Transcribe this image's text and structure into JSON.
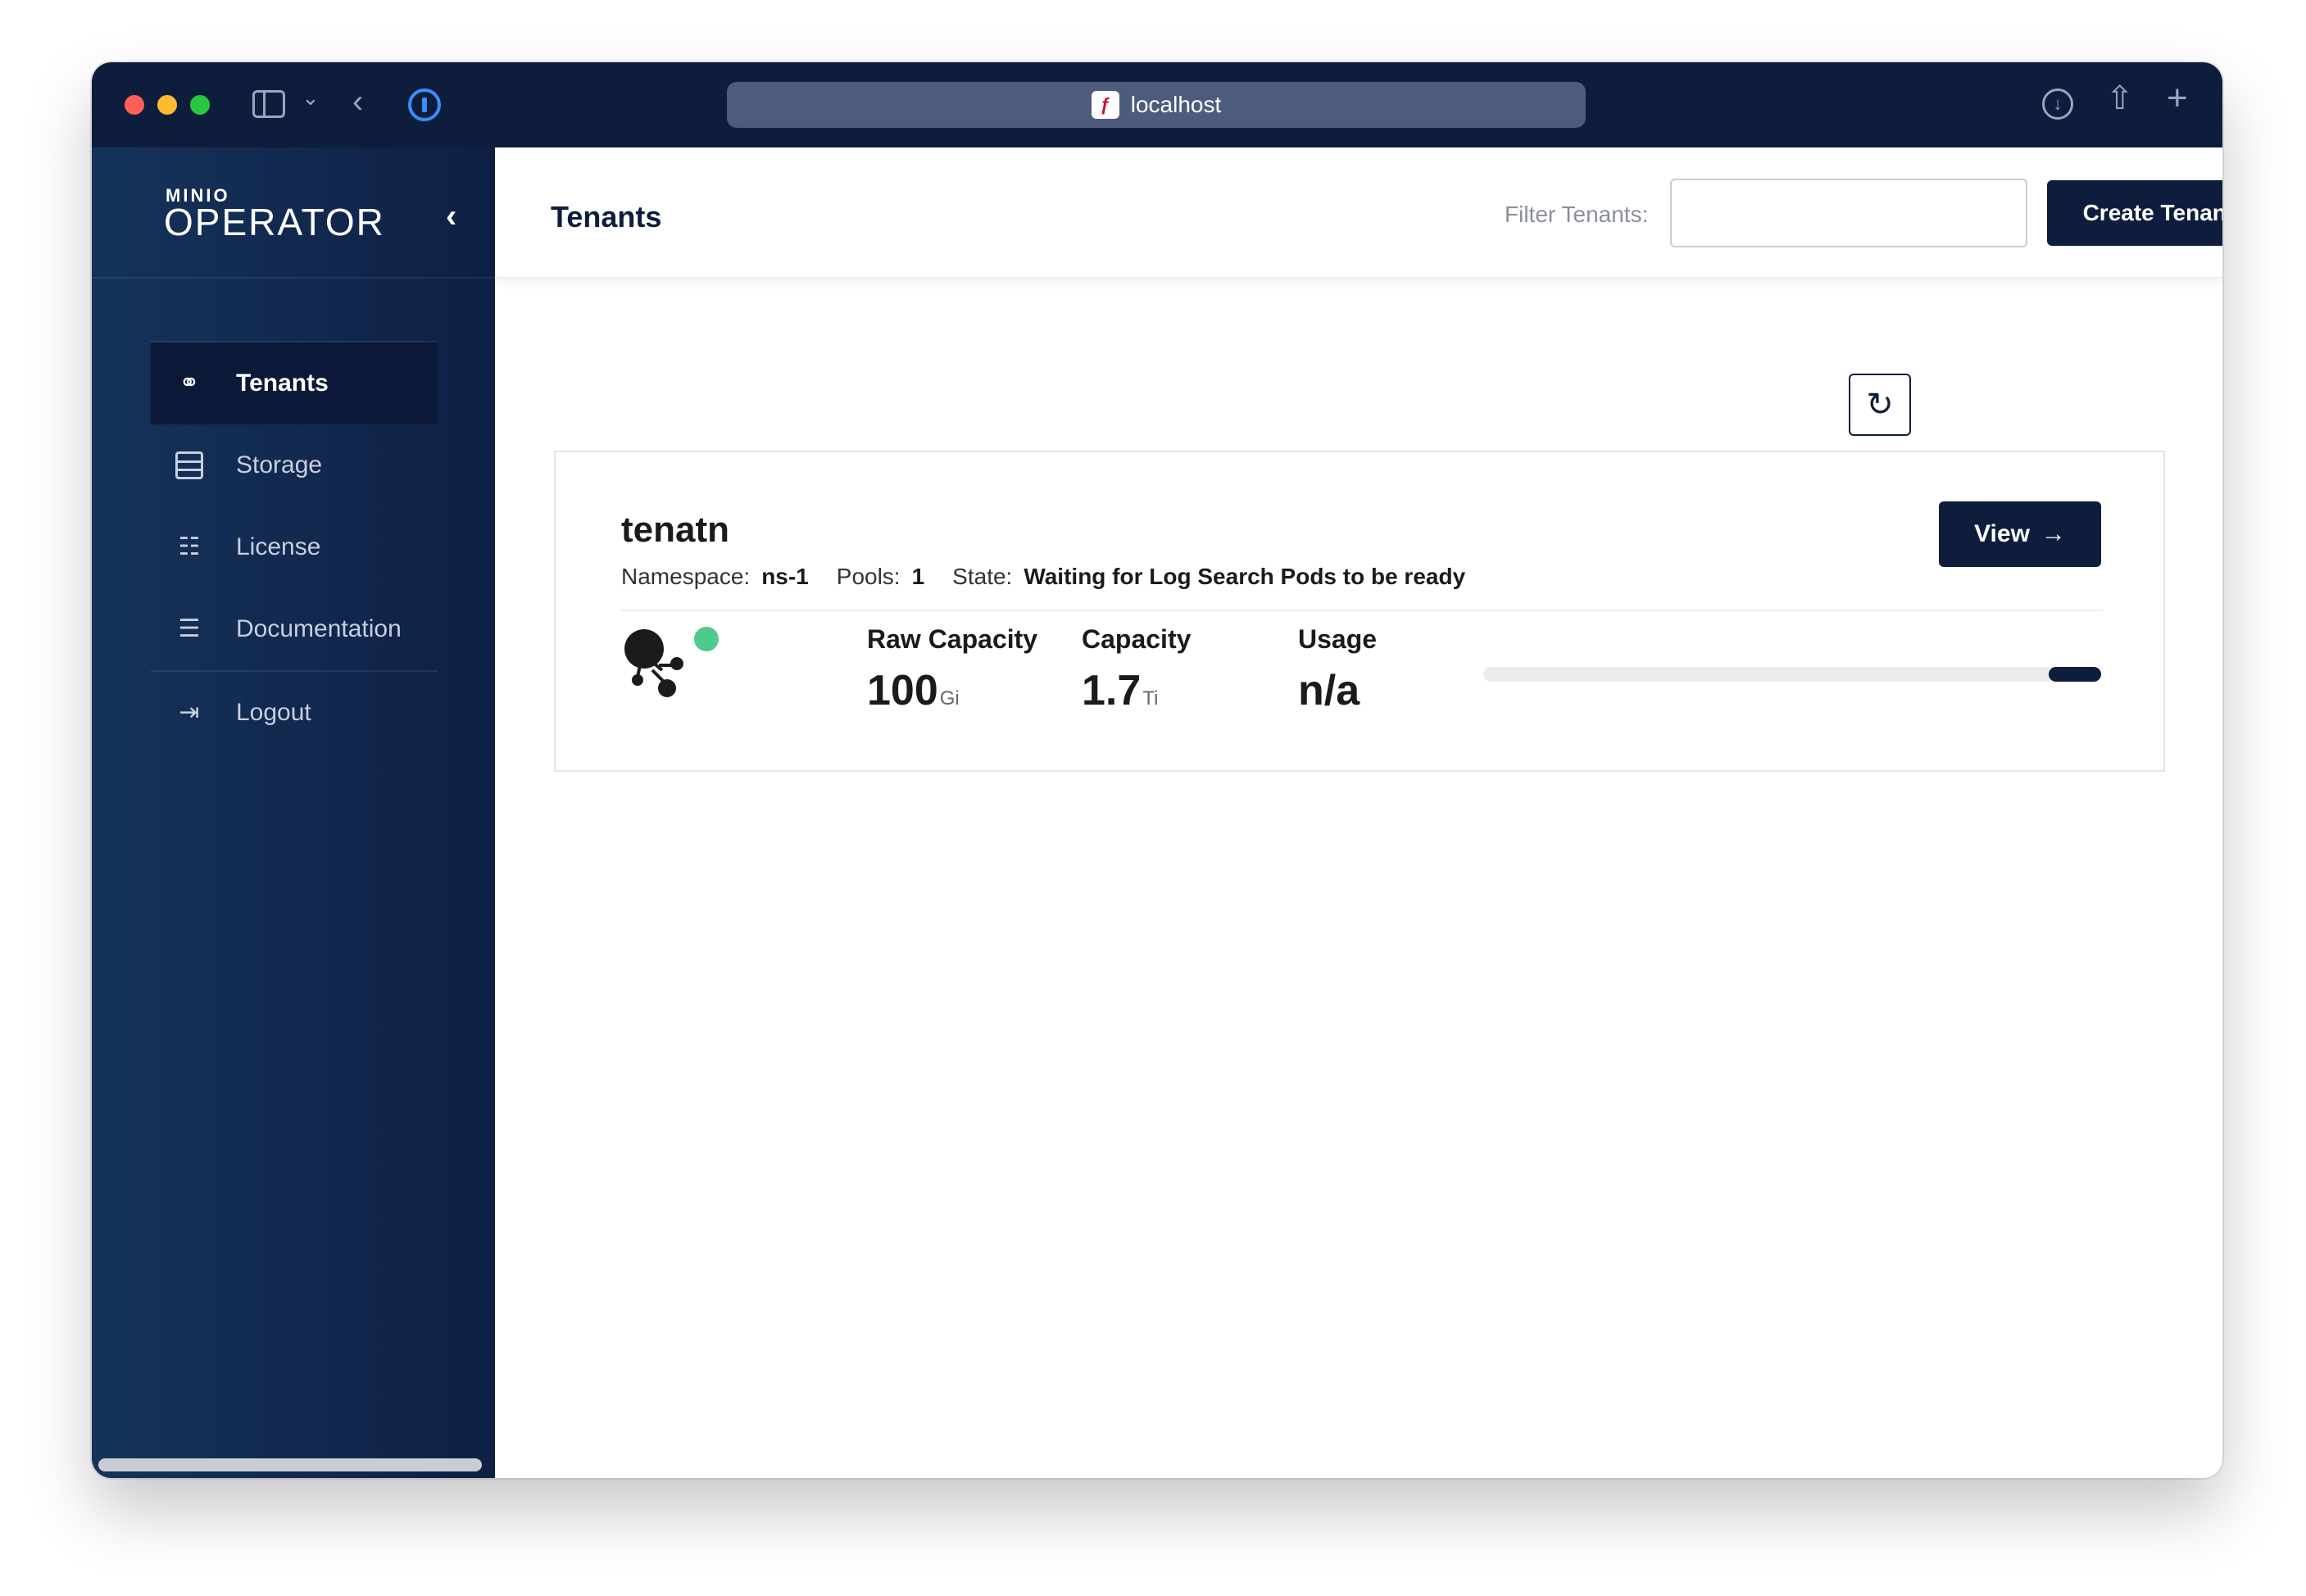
{
  "browser": {
    "url": "localhost"
  },
  "sidebar": {
    "logo_small": "MINIO",
    "logo_big": "OPERATOR",
    "items": [
      {
        "label": "Tenants",
        "icon": "tenants-icon",
        "active": true
      },
      {
        "label": "Storage",
        "icon": "storage-icon",
        "active": false
      },
      {
        "label": "License",
        "icon": "license-icon",
        "active": false
      },
      {
        "label": "Documentation",
        "icon": "documentation-icon",
        "active": false
      },
      {
        "label": "Logout",
        "icon": "logout-icon",
        "active": false
      }
    ]
  },
  "header": {
    "title": "Tenants",
    "filter_label": "Filter Tenants:",
    "filter_value": "",
    "create_label": "Create Tenant"
  },
  "tenant": {
    "name": "tenatn",
    "namespace_label": "Namespace:",
    "namespace": "ns-1",
    "pools_label": "Pools:",
    "pools": "1",
    "state_label": "State:",
    "state": "Waiting for Log Search Pods to be ready",
    "view_label": "View",
    "raw_capacity_label": "Raw Capacity",
    "raw_capacity_value": "100",
    "raw_capacity_unit": "Gi",
    "capacity_label": "Capacity",
    "capacity_value": "1.7",
    "capacity_unit": "Ti",
    "usage_label": "Usage",
    "usage_value": "n/a",
    "status_color": "#4ccb8d"
  },
  "colors": {
    "brand_navy": "#0f1d3d",
    "sidebar_gradient_start": "#15335a",
    "sidebar_gradient_end": "#0f1f45"
  }
}
